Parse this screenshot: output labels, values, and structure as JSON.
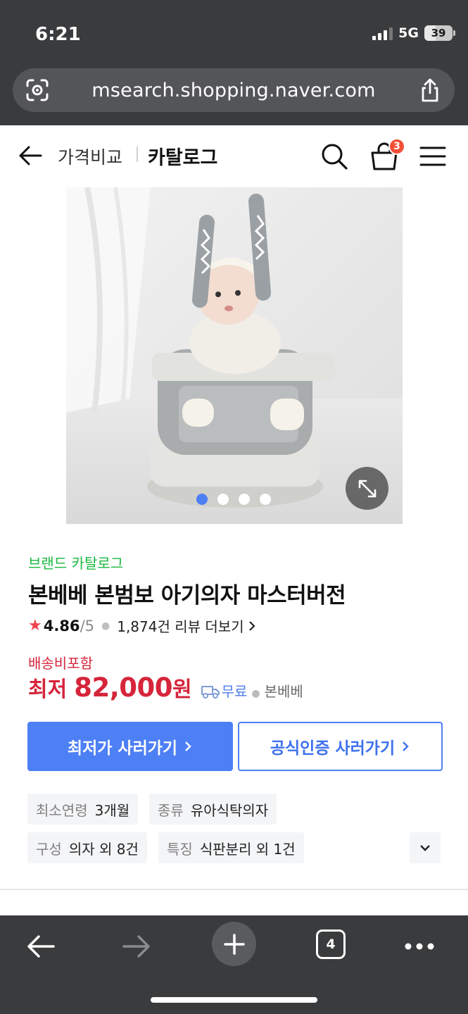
{
  "status_bar": {
    "time": "6:21",
    "network": "5G",
    "battery": "39"
  },
  "browser": {
    "url": "msearch.shopping.naver.com",
    "tab_count": "4"
  },
  "header": {
    "breadcrumb_1": "가격비교",
    "breadcrumb_2": "카탈로그",
    "cart_count": "3"
  },
  "gallery": {
    "image_count": 4,
    "active_index": 0
  },
  "product": {
    "brand_label": "브랜드 카탈로그",
    "title": "본베베 본범보 아기의자 마스터버전",
    "rating": "4.86",
    "rating_max": "/5",
    "review_text": "1,874건 리뷰 더보기",
    "shipping_note": "배송비포함",
    "price_prefix": "최저",
    "price": "82,000",
    "price_unit": "원",
    "delivery": "무료",
    "seller": "본베베"
  },
  "actions": {
    "lowest_buy": "최저가 사러가기",
    "official_buy": "공식인증 사러가기"
  },
  "specs": [
    {
      "key": "최소연령",
      "value": "3개월"
    },
    {
      "key": "종류",
      "value": "유아식탁의자"
    },
    {
      "key": "구성",
      "value": "의자 외 8건"
    },
    {
      "key": "특징",
      "value": "식판분리 외 1건"
    }
  ],
  "colors": {
    "accent_blue": "#4d7ff5",
    "price_red": "#d6253b",
    "brand_green": "#19b83f",
    "badge_red": "#f24f37"
  }
}
